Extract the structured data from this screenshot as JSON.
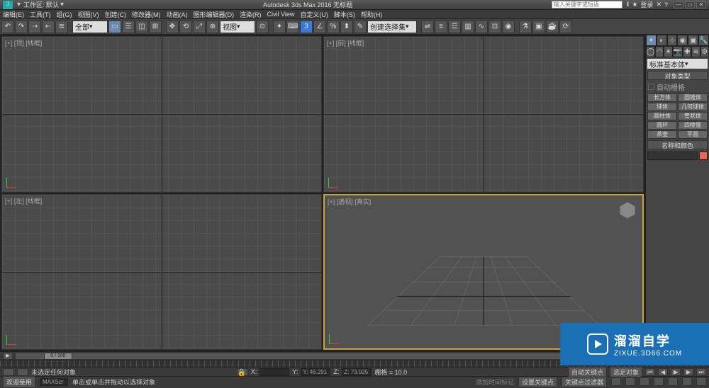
{
  "titlebar": {
    "workspace_label": "工作区: 默认",
    "app_title": "Autodesk 3ds Max 2016   无标题",
    "search_placeholder": "输入关键字或短语",
    "login": "登录"
  },
  "menu": {
    "items": [
      "编辑(E)",
      "工具(T)",
      "组(G)",
      "视图(V)",
      "创建(C)",
      "修改器(M)",
      "动画(A)",
      "图形编辑器(D)",
      "渲染(R)",
      "Civil View",
      "自定义(U)",
      "脚本(S)",
      "帮助(H)"
    ]
  },
  "toolbar": {
    "dropdown_all": "全部",
    "dropdown_view": "视图",
    "dropdown_create": "创建选择集"
  },
  "viewports": {
    "top": "[+] [顶] [线框]",
    "front": "[+] [前] [线框]",
    "left": "[+] [左] [线框]",
    "persp": "[+] [透视] [真实]"
  },
  "cmdpanel": {
    "category": "标准基本体",
    "rollout_objtype": "对象类型",
    "autogrid": "自动栅格",
    "objects": [
      "长方体",
      "圆锥体",
      "球体",
      "几何球体",
      "圆柱体",
      "管状体",
      "圆环",
      "四棱锥",
      "茶壶",
      "平面"
    ],
    "rollout_namecolor": "名称和颜色"
  },
  "timeline": {
    "range": "0 / 100"
  },
  "status": {
    "line1": "未选定任何对象",
    "line2": "单击或单击并拖动以选择对象",
    "welcome": "欢迎使用",
    "maxscript": "MAXScr",
    "x": "X:",
    "y": "Y: 46.291",
    "z": "Z: 73.925",
    "grid_label": "栅格 = 10.0",
    "addtime": "添加时间标记",
    "autokey": "自动关键点",
    "setkey": "设置关键点",
    "keyfilter": "关键点过滤器",
    "selected": "选定对象"
  },
  "watermark": {
    "brand": "溜溜自学",
    "url": "ZIXUE.3D66.COM"
  }
}
